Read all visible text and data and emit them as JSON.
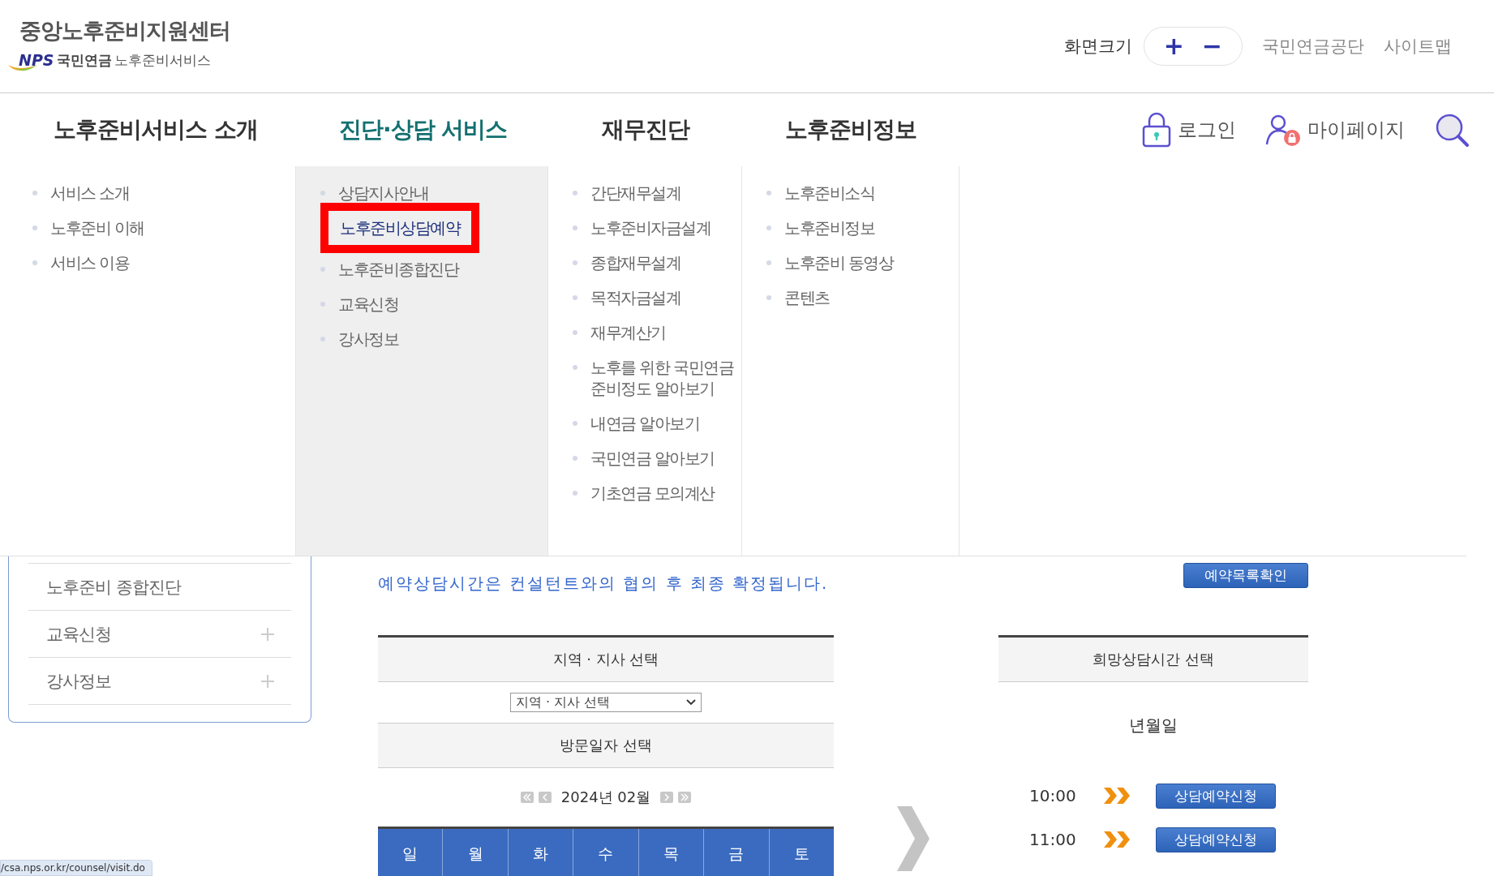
{
  "header": {
    "logo": {
      "title": "중앙노후준비지원센터",
      "brand": "NPS",
      "org": "국민연금",
      "service": "노후준비서비스"
    },
    "font_size": {
      "label": "화면크기",
      "increase": "+",
      "decrease": "−"
    },
    "links": [
      "국민연금공단",
      "사이트맵"
    ]
  },
  "nav": {
    "items": [
      {
        "label": "노후준비서비스 소개",
        "selected": false
      },
      {
        "label": "진단·상담 서비스",
        "selected": true
      },
      {
        "label": "재무진단",
        "selected": false
      },
      {
        "label": "노후준비정보",
        "selected": false
      }
    ],
    "actions": [
      {
        "kind": "login",
        "label": "로그인"
      },
      {
        "kind": "mypage",
        "label": "마이페이지"
      }
    ]
  },
  "mega_menu": [
    {
      "selected": false,
      "items": [
        {
          "label": "서비스 소개",
          "selected": false
        },
        {
          "label": "노후준비 이해",
          "selected": false
        },
        {
          "label": "서비스 이용",
          "selected": false
        }
      ]
    },
    {
      "selected": true,
      "items": [
        {
          "label": "상담지사안내",
          "selected": false
        },
        {
          "label": "노후준비상담예약",
          "selected": true
        },
        {
          "label": "노후준비종합진단",
          "selected": false
        },
        {
          "label": "교육신청",
          "selected": false
        },
        {
          "label": "강사정보",
          "selected": false
        }
      ]
    },
    {
      "selected": false,
      "items": [
        {
          "label": "간단재무설계",
          "selected": false
        },
        {
          "label": "노후준비자금설계",
          "selected": false
        },
        {
          "label": "종합재무설계",
          "selected": false
        },
        {
          "label": "목적자금설계",
          "selected": false
        },
        {
          "label": "재무계산기",
          "selected": false
        },
        {
          "label": "노후를 위한 국민연금 준비정도 알아보기",
          "selected": false
        },
        {
          "label": "내연금 알아보기",
          "selected": false
        },
        {
          "label": "국민연금 알아보기",
          "selected": false
        },
        {
          "label": "기초연금 모의계산",
          "selected": false
        }
      ]
    },
    {
      "selected": false,
      "items": [
        {
          "label": "노후준비소식",
          "selected": false
        },
        {
          "label": "노후준비정보",
          "selected": false
        },
        {
          "label": "노후준비 동영상",
          "selected": false
        },
        {
          "label": "콘텐츠",
          "selected": false
        }
      ]
    }
  ],
  "sidebar": {
    "items": [
      {
        "label": "노후준비 종합진단",
        "expandable": false
      },
      {
        "label": "교육신청",
        "expandable": true
      },
      {
        "label": "강사정보",
        "expandable": true
      }
    ]
  },
  "notice": "예약상담시간은 컨설턴트와의 협의 후 최종 확정됩니다.",
  "list_button": "예약목록확인",
  "branch_table": {
    "header": "지역 · 지사 선택",
    "select_value": "지역 · 지사 선택",
    "date_header": "방문일자 선택",
    "month": "2024년 02월",
    "weekdays": [
      "일",
      "월",
      "화",
      "수",
      "목",
      "금",
      "토"
    ]
  },
  "time_panel": {
    "header": "희망상담시간 선택",
    "date": "년월일",
    "slots": [
      {
        "time": "10:00",
        "button": "상담예약신청"
      },
      {
        "time": "11:00",
        "button": "상담예약신청"
      }
    ]
  },
  "status_url": "/csa.nps.or.kr/counsel/visit.do"
}
